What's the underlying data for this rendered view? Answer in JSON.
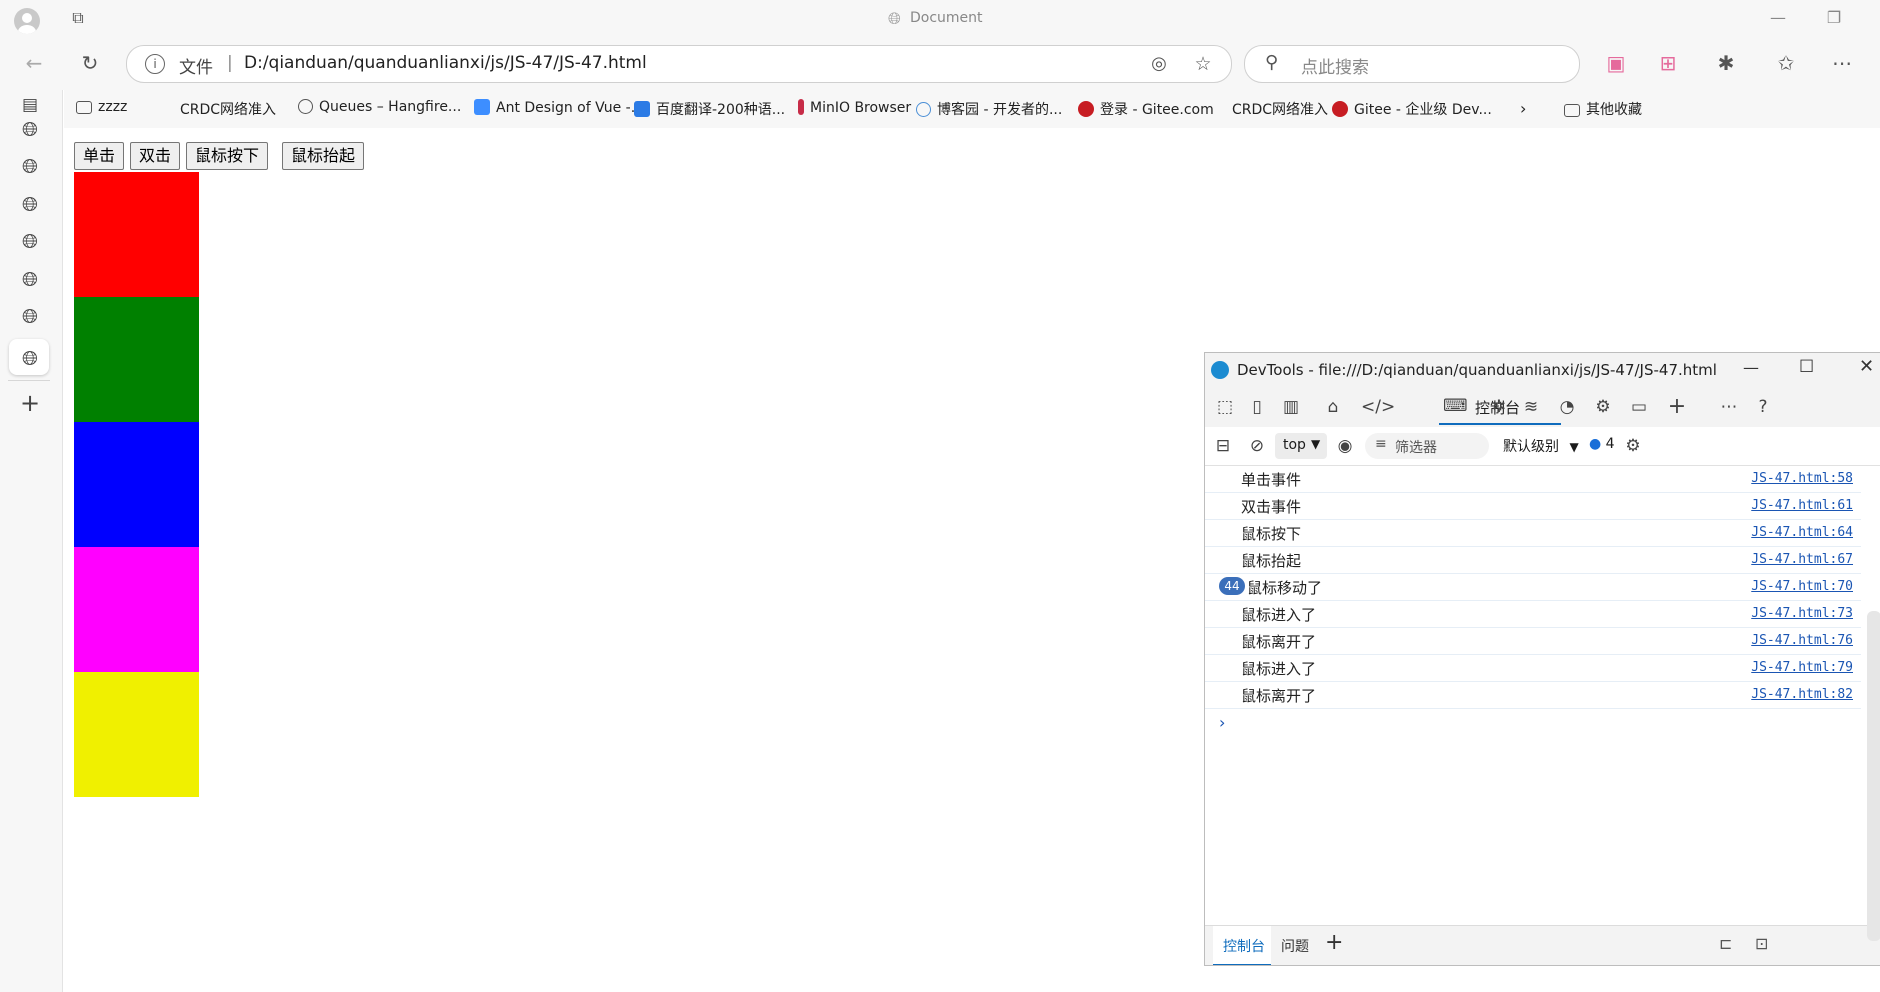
{
  "window": {
    "title": "Document"
  },
  "address_bar": {
    "scheme_label": "文件",
    "separator": "|",
    "url": "D:/qianduan/quanduanlianxi/js/JS-47/JS-47.html"
  },
  "search": {
    "placeholder": "点此搜索"
  },
  "bookmarks": [
    {
      "label": "zzzz",
      "icon": "folder-icon"
    },
    {
      "label": "CRDC网络准入",
      "icon": ""
    },
    {
      "label": "Queues – Hangfire...",
      "icon": "globe-icon"
    },
    {
      "label": "Ant Design of Vue -...",
      "icon": "antdv-icon"
    },
    {
      "label": "百度翻译-200种语...",
      "icon": "baidu-translate-icon"
    },
    {
      "label": "MinIO Browser",
      "icon": "minio-icon"
    },
    {
      "label": "博客园 - 开发者的...",
      "icon": "cnblogs-icon"
    },
    {
      "label": "登录 - Gitee.com",
      "icon": "gitee-icon"
    },
    {
      "label": "CRDC网络准入",
      "icon": ""
    },
    {
      "label": "Gitee - 企业级 Dev...",
      "icon": "gitee-icon"
    },
    {
      "label": "其他收藏",
      "icon": "folder-icon"
    }
  ],
  "page": {
    "buttons": {
      "click": "单击",
      "dblclick": "双击",
      "mousedown": "鼠标按下",
      "mouseup": "鼠标抬起"
    },
    "boxes": [
      {
        "name": "red-box",
        "color": "#ff0000"
      },
      {
        "name": "green-box",
        "color": "#008000"
      },
      {
        "name": "blue-box",
        "color": "#0000ff"
      },
      {
        "name": "magenta-box",
        "color": "#ff00ff"
      },
      {
        "name": "yellow-box",
        "color": "#f0f000"
      }
    ]
  },
  "devtools": {
    "title": "DevTools - file:///D:/qianduan/quanduanlianxi/js/JS-47/JS-47.html",
    "console_tab": "控制台",
    "context": "top",
    "filter_placeholder": "筛选器",
    "level": "默认级别",
    "message_count": "4",
    "logs": [
      {
        "message": "单击事件",
        "source": "JS-47.html:58"
      },
      {
        "message": "双击事件",
        "source": "JS-47.html:61"
      },
      {
        "message": "鼠标按下",
        "source": "JS-47.html:64"
      },
      {
        "message": "鼠标抬起",
        "source": "JS-47.html:67"
      },
      {
        "count": "44",
        "message": "鼠标移动了",
        "source": "JS-47.html:70"
      },
      {
        "message": "鼠标进入了",
        "source": "JS-47.html:73"
      },
      {
        "message": "鼠标离开了",
        "source": "JS-47.html:76"
      },
      {
        "message": "鼠标进入了",
        "source": "JS-47.html:79"
      },
      {
        "message": "鼠标离开了",
        "source": "JS-47.html:82"
      }
    ],
    "drawer_tabs": {
      "console": "控制台",
      "issues": "问题"
    }
  }
}
